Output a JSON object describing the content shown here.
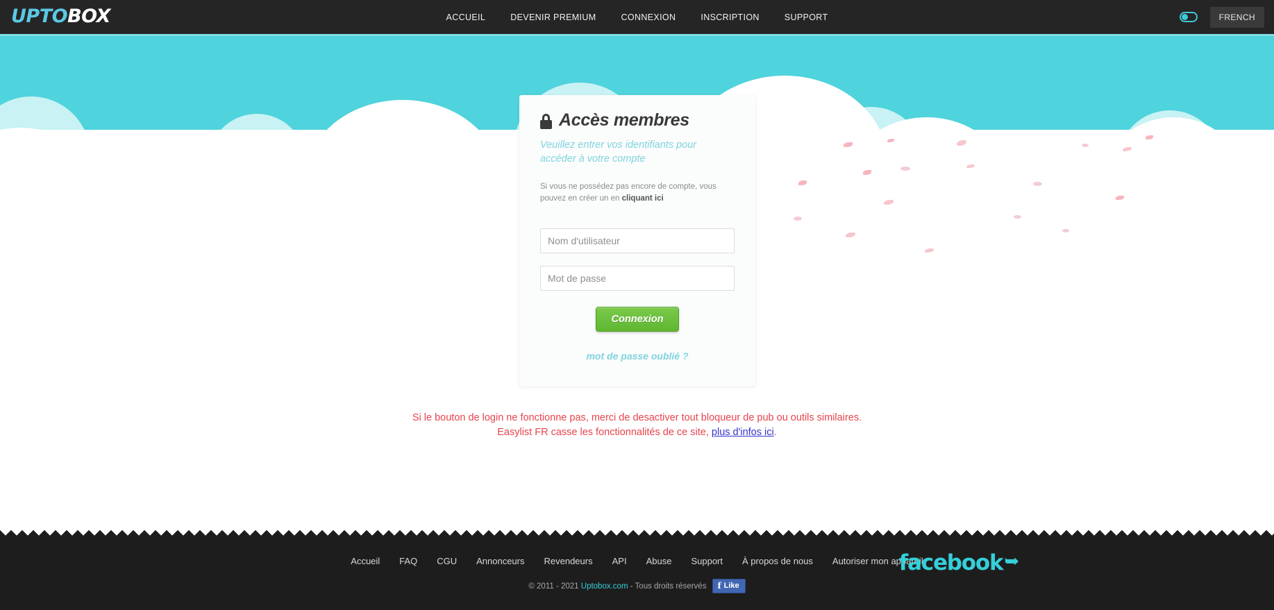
{
  "brand": {
    "logo_part1": "UPTO",
    "logo_part2": "BOX",
    "accent_cyan": "#35cfd9",
    "sky_color": "#4fd3dc",
    "button_green": "#5fb731",
    "warning_red": "#e8434c"
  },
  "nav": {
    "items": [
      {
        "label": "ACCUEIL"
      },
      {
        "label": "DEVENIR PREMIUM"
      },
      {
        "label": "CONNEXION"
      },
      {
        "label": "INSCRIPTION"
      },
      {
        "label": "SUPPORT"
      }
    ],
    "theme_toggle_name": "theme-toggle-switch",
    "language": "FRENCH"
  },
  "login": {
    "title": "Accès membres",
    "subtitle": "Veuillez entrer vos identifiants pour accéder à votre compte",
    "note_prefix": "Si vous ne possédez pas encore de compte, vous pouvez en créer un en ",
    "note_link": "cliquant ici",
    "username_placeholder": "Nom d'utilisateur",
    "username_value": "",
    "password_placeholder": "Mot de passe",
    "password_value": "",
    "submit_label": "Connexion",
    "forgot_label": "mot de passe oublié ?"
  },
  "warning": {
    "line1": "Si le bouton de login ne fonctionne pas, merci de desactiver tout bloqueur de pub ou outils similaires.",
    "line2_prefix": "Easylist FR casse les fonctionnalités de ce site, ",
    "line2_link": "plus d'infos ici",
    "line2_suffix": "."
  },
  "footer": {
    "links": [
      {
        "label": "Accueil"
      },
      {
        "label": "FAQ"
      },
      {
        "label": "CGU"
      },
      {
        "label": "Annonceurs"
      },
      {
        "label": "Revendeurs"
      },
      {
        "label": "API"
      },
      {
        "label": "Abuse"
      },
      {
        "label": "Support"
      },
      {
        "label": "À propos de nous"
      },
      {
        "label": "Autoriser mon appareil"
      }
    ],
    "facebook_wordmark": "facebook",
    "copyright_prefix": "© 2011 - 2021 ",
    "copyright_link": "Uptobox.com",
    "copyright_suffix": " - Tous droits réservés",
    "like_label": "Like",
    "like_icon_glyph": "f"
  }
}
